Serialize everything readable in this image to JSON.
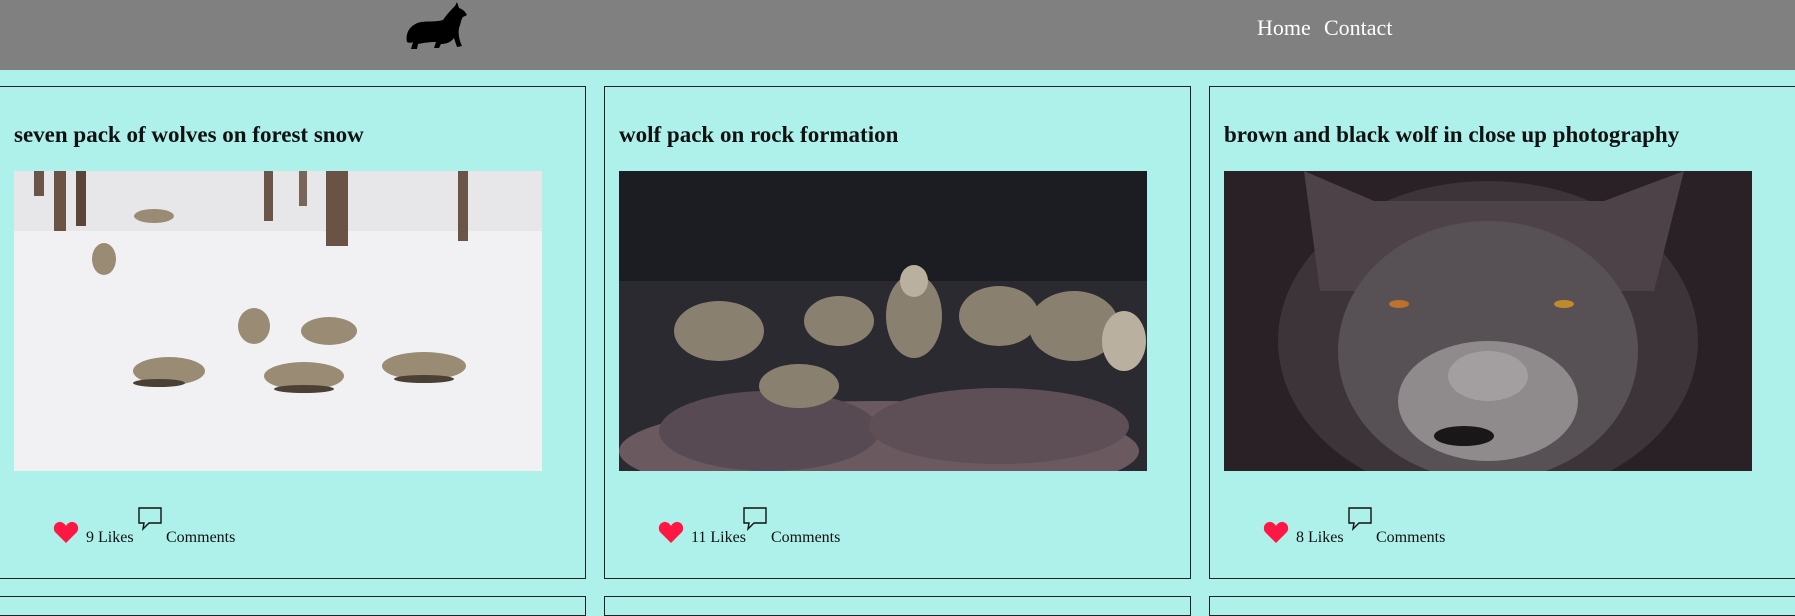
{
  "nav": {
    "logo_icon": "wolf-howling-icon",
    "links": [
      "Home",
      "Contact"
    ]
  },
  "posts": [
    {
      "title": "seven pack of wolves on forest snow",
      "likes": "9 Likes",
      "comments": "Comments"
    },
    {
      "title": "wolf pack on rock formation",
      "likes": "11 Likes",
      "comments": "Comments"
    },
    {
      "title": "brown and black wolf in close up photography",
      "likes": "8 Likes",
      "comments": "Comments"
    }
  ],
  "colors": {
    "background": "#aef1eb",
    "navbar": "#808080",
    "heart": "#ff1744"
  }
}
